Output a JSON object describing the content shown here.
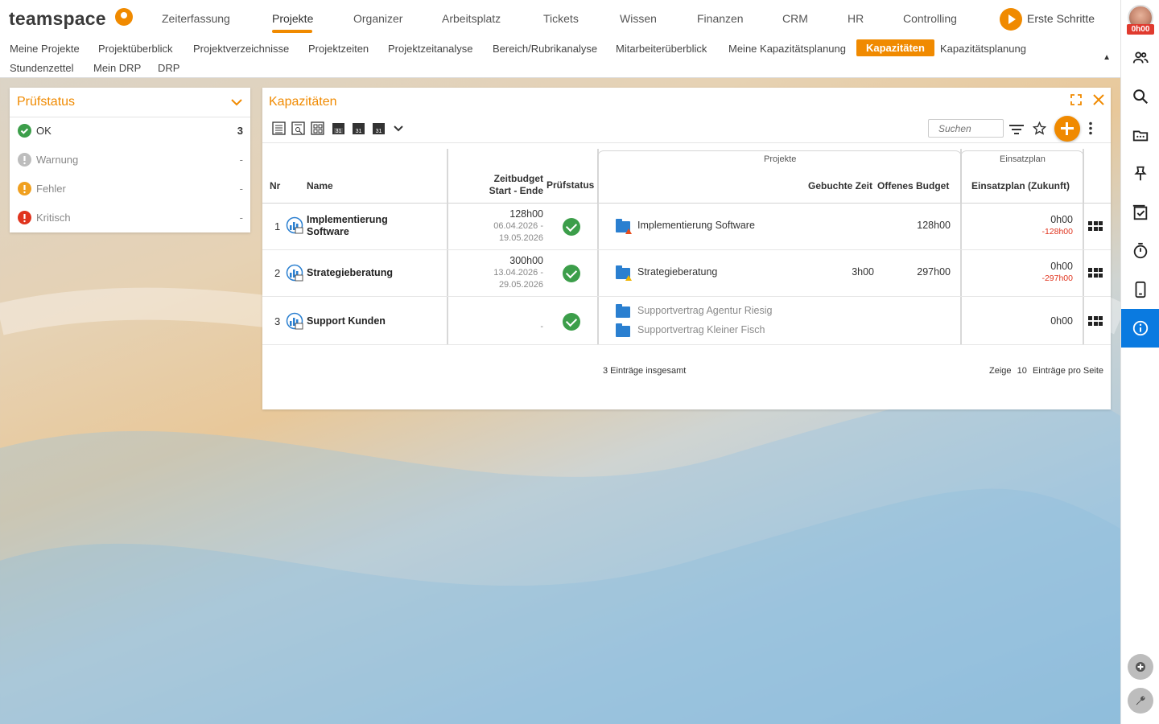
{
  "app": {
    "logo_text": "teamspace",
    "user_time_badge": "0h00"
  },
  "nav": {
    "items": [
      "Zeiterfassung",
      "Projekte",
      "Organizer",
      "Arbeitsplatz",
      "Tickets",
      "Wissen",
      "Finanzen",
      "CRM",
      "HR",
      "Controlling"
    ],
    "active": "Projekte",
    "getting_started": "Erste Schritte"
  },
  "subnav": {
    "row1": [
      "Meine Projekte",
      "Projektüberblick",
      "Projektverzeichnisse",
      "Projektzeiten",
      "Projektzeitanalyse",
      "Bereich/Rubrikanalyse",
      "Mitarbeiterüberblick",
      "Meine Kapazitätsplanung",
      "Kapazitäten",
      "Kapazitätsplanung"
    ],
    "row2": [
      "Stundenzettel",
      "Mein DRP",
      "DRP"
    ],
    "active": "Kapazitäten"
  },
  "pruefstatus": {
    "title": "Prüfstatus",
    "rows": [
      {
        "label": "OK",
        "count": "3",
        "color": "#3c9e4a"
      },
      {
        "label": "Warnung",
        "count": "-",
        "color": "#bdbdbd"
      },
      {
        "label": "Fehler",
        "count": "-",
        "color": "#f0a020"
      },
      {
        "label": "Kritisch",
        "count": "-",
        "color": "#e0341e"
      }
    ]
  },
  "kapazitaeten": {
    "title": "Kapazitäten",
    "search_placeholder": "Suchen",
    "headers": {
      "nr": "Nr",
      "name": "Name",
      "zeitbudget": "Zeitbudget",
      "start_ende": "Start - Ende",
      "pruefstatus": "Prüfstatus",
      "group_projekte": "Projekte",
      "gebuchte_zeit": "Gebuchte Zeit",
      "offenes_budget": "Offenes Budget",
      "group_einsatzplan": "Einsatzplan",
      "einsatzplan_zukunft": "Einsatzplan (Zukunft)"
    },
    "rows": [
      {
        "nr": "1",
        "name_line1": "Implementierung",
        "name_line2": "Software",
        "budget": "128h00",
        "start": "06.04.2026 -",
        "end": "19.05.2026",
        "projekte": [
          {
            "name": "Implementierung Software",
            "gebucht": "",
            "offen": "128h00"
          }
        ],
        "einsatz": "0h00",
        "einsatz_neg": "-128h00"
      },
      {
        "nr": "2",
        "name_line1": "Strategieberatung",
        "name_line2": "",
        "budget": "300h00",
        "start": "13.04.2026 -",
        "end": "29.05.2026",
        "projekte": [
          {
            "name": "Strategieberatung",
            "gebucht": "3h00",
            "offen": "297h00"
          }
        ],
        "einsatz": "0h00",
        "einsatz_neg": "-297h00"
      },
      {
        "nr": "3",
        "name_line1": "Support Kunden",
        "name_line2": "",
        "budget": "",
        "start": "-",
        "end": "",
        "projekte": [
          {
            "name": "Supportvertrag Agentur Riesig"
          },
          {
            "name": "Supportvertrag Kleiner Fisch"
          }
        ],
        "einsatz": "0h00",
        "einsatz_neg": ""
      }
    ],
    "footer_total": "3 Einträge insgesamt",
    "footer_zeige": "Zeige",
    "footer_pagesize": "10",
    "footer_pro_seite": "Einträge pro Seite"
  }
}
